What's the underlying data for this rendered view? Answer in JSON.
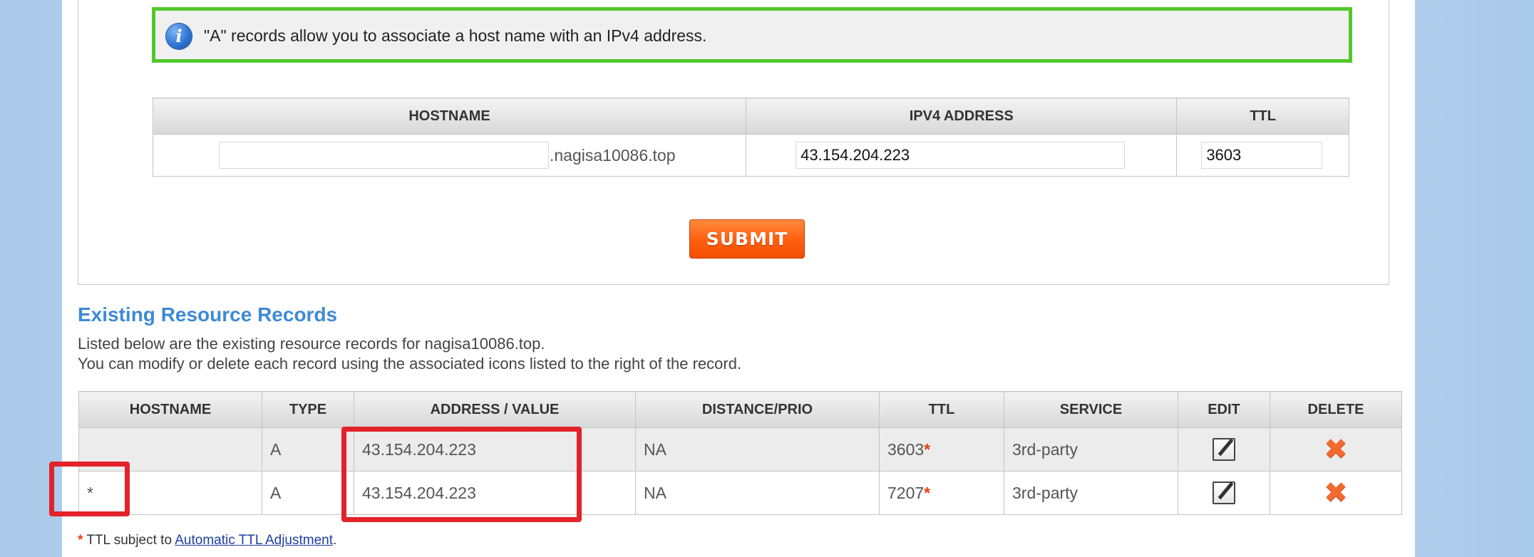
{
  "info": {
    "icon": "info-icon",
    "text": "\"A\" records allow you to associate a host name with an IPv4 address."
  },
  "form": {
    "headers": [
      "HOSTNAME",
      "IPV4 ADDRESS",
      "TTL"
    ],
    "hostname_value": "",
    "domain_suffix": ".nagisa10086.top",
    "ipv4_value": "43.154.204.223",
    "ttl_value": "3603",
    "submit_label": "SUBMIT"
  },
  "records": {
    "title": "Existing Resource Records",
    "description_line1": "Listed below are the existing resource records for nagisa10086.top.",
    "description_line2": "You can modify or delete each record using the associated icons listed to the right of the record.",
    "headers": [
      "HOSTNAME",
      "TYPE",
      "ADDRESS / VALUE",
      "DISTANCE/PRIO",
      "TTL",
      "SERVICE",
      "EDIT",
      "DELETE"
    ],
    "rows": [
      {
        "hostname": "",
        "type": "A",
        "address": "43.154.204.223",
        "prio": "NA",
        "ttl": "3603",
        "ttl_mark": "*",
        "service": "3rd-party"
      },
      {
        "hostname": "*",
        "type": "A",
        "address": "43.154.204.223",
        "prio": "NA",
        "ttl": "7207",
        "ttl_mark": "*",
        "service": "3rd-party"
      }
    ]
  },
  "footnote": {
    "mark": "*",
    "text": " TTL subject to ",
    "link": "Automatic TTL Adjustment",
    "end": "."
  },
  "colors": {
    "info_border": "#52c82b",
    "highlight": "#e3222a",
    "title": "#3e8ad6",
    "submit": "#ff6112"
  }
}
